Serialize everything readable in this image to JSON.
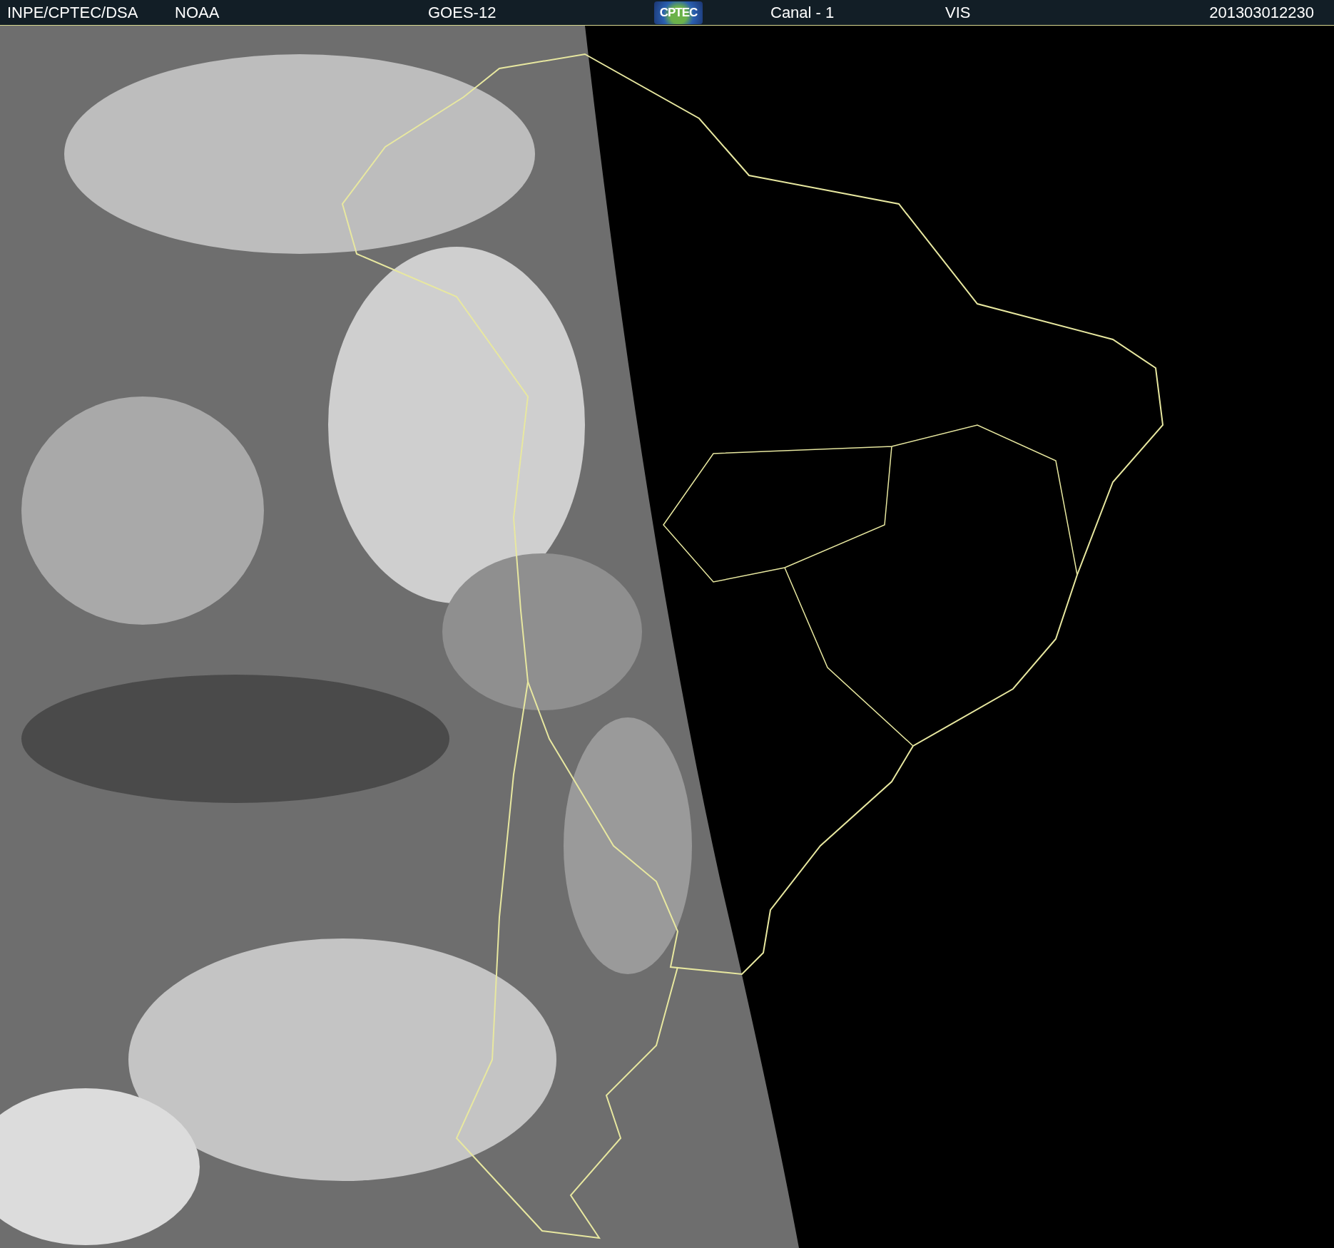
{
  "header": {
    "source": "INPE/CPTEC/DSA",
    "agency": "NOAA",
    "satellite": "GOES-12",
    "logo_text": "CPTEC",
    "channel": "Canal - 1",
    "band": "VIS",
    "timestamp": "201303012230"
  }
}
